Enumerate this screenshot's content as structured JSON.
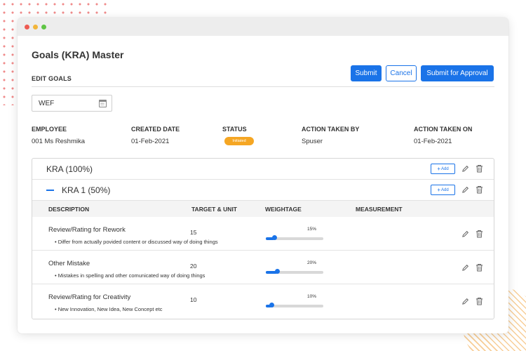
{
  "page": {
    "title": "Goals (KRA) Master",
    "section": "EDIT GOALS"
  },
  "toolbar": {
    "submit_label": "Submit",
    "cancel_label": "Cancel",
    "approval_label": "Submit for Approval"
  },
  "wef": {
    "value": "WEF"
  },
  "info": {
    "employee_label": "EMPLOYEE",
    "employee_value": "001 Ms Reshmika",
    "created_label": "CREATED DATE",
    "created_value": "01-Feb-2021",
    "status_label": "STATUS",
    "status_value": "Initiated",
    "action_by_label": "ACTION TAKEN BY",
    "action_by_value": "Spuser",
    "action_on_label": "ACTION TAKEN ON",
    "action_on_value": "01-Feb-2021"
  },
  "kra": {
    "title": "KRA (100%)",
    "add_label": "Add",
    "sub_title": "KRA 1 (50%)",
    "sub_add_label": "Add"
  },
  "columns": {
    "description": "DESCRIPTION",
    "target": "TARGET & UNIT",
    "weightage": "WEIGHTAGE",
    "measurement": "MEASUREMENT"
  },
  "items": [
    {
      "description": "Review/Rating for Rework",
      "detail": "• Differ from actually povided content or discussed way of doing things",
      "target": "15",
      "weightage_label": "15%",
      "weightage": 15
    },
    {
      "description": "Other Mistake",
      "detail": "• Mistakes in spelling and other comunicated way of doing things",
      "target": "20",
      "weightage_label": "20%",
      "weightage": 20
    },
    {
      "description": "Review/Rating for Creativity",
      "detail": "• New Innovation, New Idea, New Concept etc",
      "target": "10",
      "weightage_label": "10%",
      "weightage": 10
    }
  ],
  "colors": {
    "accent": "#1a73e8",
    "status": "#f5a623",
    "window_red": "#ee5b52",
    "window_yellow": "#f2b53a",
    "window_green": "#5fc544"
  },
  "icons": {
    "edit": "pencil-icon",
    "delete": "trash-icon",
    "calendar": "calendar-icon",
    "collapse": "minus-icon",
    "add": "plus-icon"
  }
}
